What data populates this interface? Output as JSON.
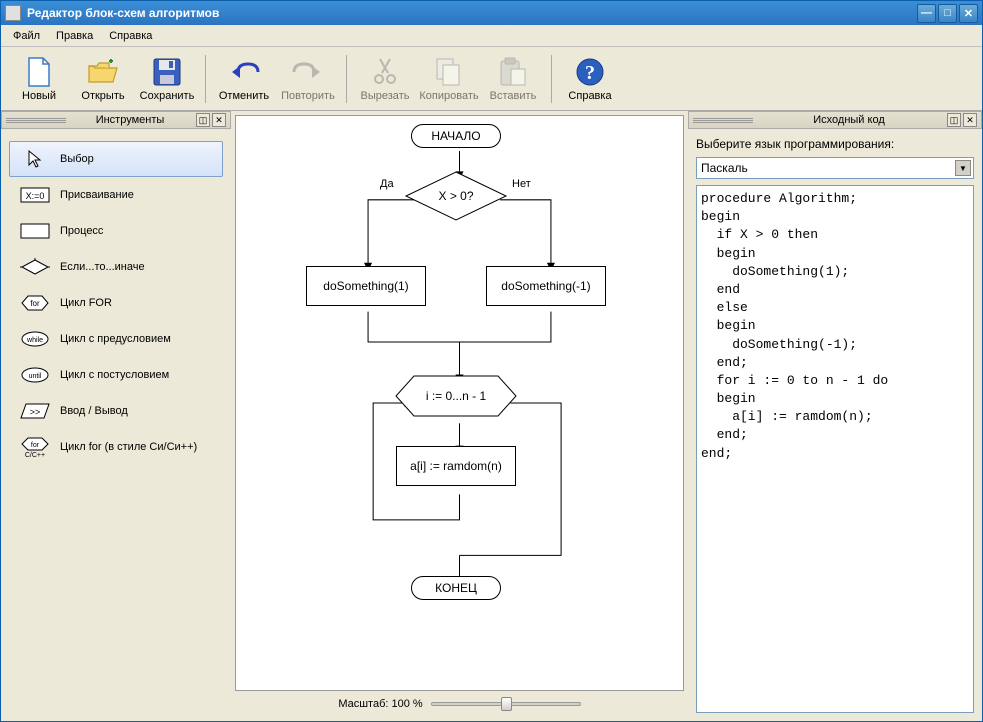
{
  "window": {
    "title": "Редактор блок-схем алгоритмов"
  },
  "menu": {
    "file": "Файл",
    "edit": "Правка",
    "help": "Справка"
  },
  "toolbar": {
    "new": "Новый",
    "open": "Открыть",
    "save": "Сохранить",
    "undo": "Отменить",
    "redo": "Повторить",
    "cut": "Вырезать",
    "copy": "Копировать",
    "paste": "Вставить",
    "help": "Справка"
  },
  "panels": {
    "tools_title": "Инструменты",
    "code_title": "Исходный код"
  },
  "tools": {
    "select": "Выбор",
    "assign": "Присваивание",
    "process": "Процесс",
    "ifelse": "Если...то...иначе",
    "for": "Цикл FOR",
    "while": "Цикл с предусловием",
    "until": "Цикл с постусловием",
    "io": "Ввод / Вывод",
    "cfor": "Цикл for (в стиле Си/Си++)"
  },
  "flowchart": {
    "start": "НАЧАЛО",
    "end": "КОНЕЦ",
    "cond": "X > 0?",
    "yes": "Да",
    "no": "Нет",
    "p1": "doSomething(1)",
    "p2": "doSomething(-1)",
    "loop": "i := 0...n - 1",
    "body": "a[i] := ramdom(n)"
  },
  "zoom": {
    "label": "Масштаб: 100 %"
  },
  "code": {
    "lang_label": "Выберите язык программирования:",
    "lang_selected": "Паскаль",
    "text": "procedure Algorithm;\nbegin\n  if X > 0 then\n  begin\n    doSomething(1);\n  end\n  else\n  begin\n    doSomething(-1);\n  end;\n  for i := 0 to n - 1 do\n  begin\n    a[i] := ramdom(n);\n  end;\nend;"
  }
}
